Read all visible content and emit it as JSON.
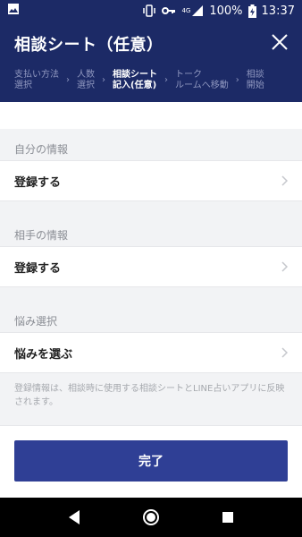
{
  "status_bar": {
    "battery": "100%",
    "time": "13:37",
    "network": "4G"
  },
  "header": {
    "title": "相談シート（任意）"
  },
  "steps": [
    {
      "label": "支払い方法\n選択",
      "active": false
    },
    {
      "label": "人数\n選択",
      "active": false
    },
    {
      "label": "相談シート\n記入(任意)",
      "active": true
    },
    {
      "label": "トーク\nルームへ移動",
      "active": false
    },
    {
      "label": "相談\n開始",
      "active": false
    }
  ],
  "sections": [
    {
      "label": "自分の情報",
      "row_label": "登録する"
    },
    {
      "label": "相手の情報",
      "row_label": "登録する"
    },
    {
      "label": "悩み選択",
      "row_label": "悩みを選ぶ"
    }
  ],
  "note": "登録情報は、相談時に使用する相談シートとLINE占いアプリに反映されます。",
  "footer": {
    "done_label": "完了"
  },
  "colors": {
    "header_bg": "#1c2a66",
    "button_bg": "#2f3f95"
  }
}
